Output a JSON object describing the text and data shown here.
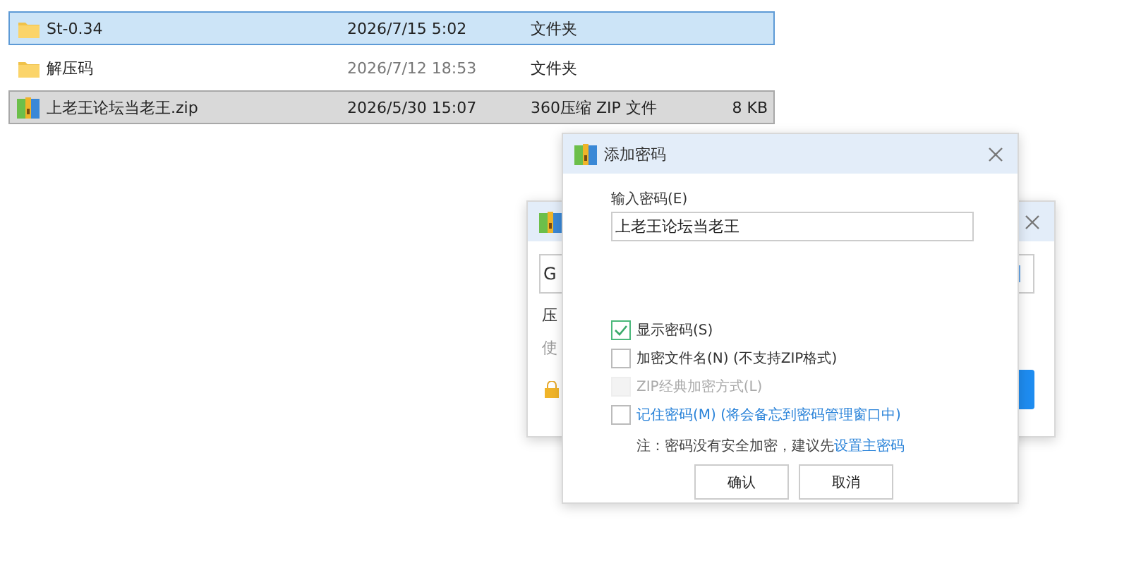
{
  "files": [
    {
      "name": "St-0.34",
      "date": "2026/7/15 5:02",
      "type": "文件夹",
      "kind": "folder",
      "selected": true,
      "muted": false
    },
    {
      "name": "解压码",
      "date": "2026/7/12 18:53",
      "type": "文件夹",
      "kind": "folder",
      "selected": false,
      "muted": true
    },
    {
      "name": "上老王论坛当老王.zip",
      "date": "2026/5/30 15:07",
      "type": "360压缩 ZIP 文件",
      "size": "8 KB",
      "kind": "archive",
      "selected": false,
      "muted": false
    }
  ],
  "back_dialog": {
    "field_value": "G",
    "line_1": "压",
    "line_2": "使"
  },
  "dialog": {
    "title": "添加密码",
    "label": "输入密码(E)",
    "password": "上老王论坛当老王",
    "options": [
      {
        "label": "显示密码(S)",
        "checked": true,
        "disabled": false,
        "kind": "plain"
      },
      {
        "label": "加密文件名(N) (不支持ZIP格式)",
        "checked": false,
        "disabled": false,
        "kind": "plain"
      },
      {
        "label": "ZIP经典加密方式(L)",
        "checked": false,
        "disabled": true,
        "kind": "plain"
      },
      {
        "label": "记住密码(M) (将会备忘到密码管理窗口中)",
        "checked": false,
        "disabled": false,
        "kind": "link"
      }
    ],
    "note": "注：密码没有安全加密，建议先",
    "note_link": "设置主密码",
    "buttons": [
      "确认",
      "取消"
    ]
  }
}
